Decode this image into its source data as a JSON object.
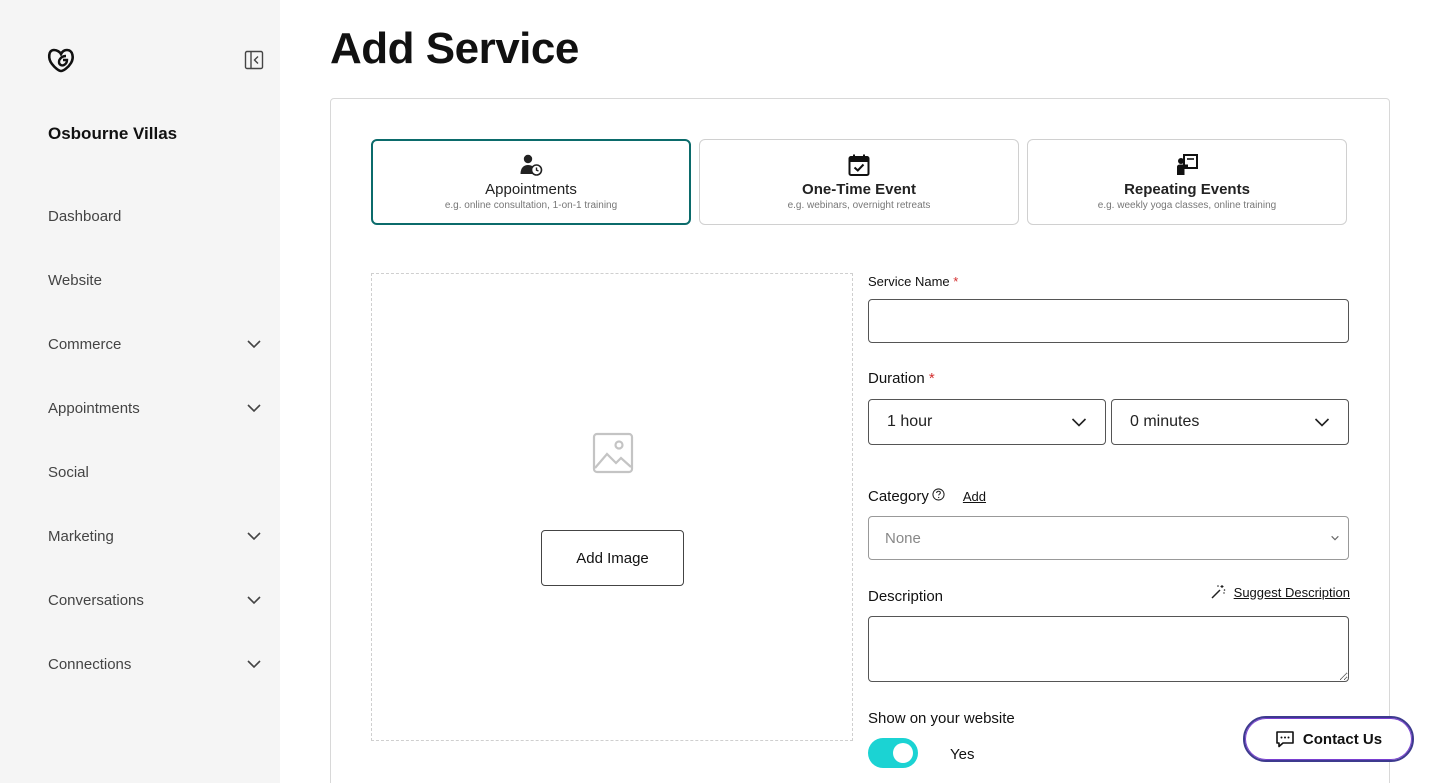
{
  "sidebar": {
    "logo_icon": "godaddy-logo-icon",
    "collapse_icon": "sidebar-collapse-icon",
    "site_name": "Osbourne Villas",
    "items": [
      {
        "label": "Dashboard",
        "expandable": false
      },
      {
        "label": "Website",
        "expandable": false
      },
      {
        "label": "Commerce",
        "expandable": true
      },
      {
        "label": "Appointments",
        "expandable": true
      },
      {
        "label": "Social",
        "expandable": false
      },
      {
        "label": "Marketing",
        "expandable": true
      },
      {
        "label": "Conversations",
        "expandable": true
      },
      {
        "label": "Connections",
        "expandable": true
      }
    ]
  },
  "page": {
    "title": "Add Service"
  },
  "service_types": [
    {
      "icon": "person-clock-icon",
      "title": "Appointments",
      "subtitle": "e.g. online consultation, 1-on-1 training",
      "selected": true
    },
    {
      "icon": "calendar-check-icon",
      "title": "One-Time Event",
      "subtitle": "e.g. webinars, overnight retreats",
      "selected": false
    },
    {
      "icon": "repeating-events-icon",
      "title": "Repeating Events",
      "subtitle": "e.g. weekly yoga classes, online training",
      "selected": false
    }
  ],
  "image": {
    "placeholder_icon": "image-icon",
    "button_label": "Add Image"
  },
  "form": {
    "service_name": {
      "label": "Service Name",
      "required_mark": "*",
      "value": ""
    },
    "duration": {
      "label": "Duration",
      "required_mark": "*",
      "hours_value": "1 hour",
      "minutes_value": "0 minutes"
    },
    "category": {
      "label": "Category",
      "help_icon": "question-circle-icon",
      "add_link": "Add",
      "value": "None"
    },
    "description": {
      "label": "Description",
      "suggest_icon": "magic-wand-icon",
      "suggest_link": "Suggest Description",
      "value": ""
    },
    "show_on_website": {
      "label": "Show on your website",
      "toggle_on": true,
      "value_label": "Yes"
    }
  },
  "contact": {
    "icon": "chat-icon",
    "label": "Contact Us"
  },
  "colors": {
    "sidebar_bg": "#f5f5f5",
    "selected_border": "#0b6b6b",
    "toggle_on": "#1bd3d3",
    "required": "#d32f2f",
    "contact_border": "#3d3a8e"
  }
}
